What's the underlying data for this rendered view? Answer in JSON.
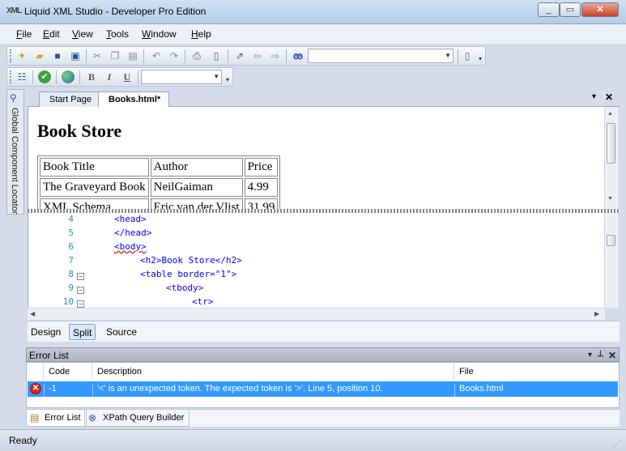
{
  "window": {
    "title": "Liquid XML Studio - Developer Pro Edition",
    "app_icon_text": "XML",
    "controls": {
      "minimize": "_",
      "maximize": "▭",
      "close": "✕"
    }
  },
  "menu": [
    {
      "label": "File",
      "key": "F",
      "rest": "ile"
    },
    {
      "label": "Edit",
      "key": "E",
      "rest": "dit"
    },
    {
      "label": "View",
      "key": "V",
      "rest": "iew"
    },
    {
      "label": "Tools",
      "key": "T",
      "rest": "ools"
    },
    {
      "label": "Window",
      "key": "W",
      "rest": "indow"
    },
    {
      "label": "Help",
      "key": "H",
      "rest": "elp"
    }
  ],
  "toolbar1": {
    "search_value": "",
    "icons": [
      "new-icon",
      "open-icon",
      "save-icon",
      "save-all-icon",
      "cut-icon",
      "copy-icon",
      "paste-icon",
      "undo-icon",
      "redo-icon",
      "print-icon",
      "print-preview-icon",
      "goto-icon",
      "back-icon",
      "forward-icon",
      "find-icon"
    ]
  },
  "toolbar2": {
    "bold": "B",
    "italic": "I",
    "underline": "U",
    "format_value": ""
  },
  "side_panel": {
    "label": "Global Component Locator"
  },
  "doc_tabs": [
    {
      "label": "Start Page",
      "active": false
    },
    {
      "label": "Books.html*",
      "active": true
    }
  ],
  "doc_tab_controls": {
    "dropdown": "▾",
    "close": "✕"
  },
  "design": {
    "heading": "Book Store",
    "table": {
      "headers": [
        "Book Title",
        "Author",
        "Price"
      ],
      "rows": [
        [
          "The Graveyard Book",
          "NeilGaiman",
          "4.99"
        ],
        [
          "XML Schema",
          "Eric van der Vlist",
          "31.99"
        ]
      ]
    }
  },
  "code": {
    "lines": [
      {
        "num": "4",
        "indent": "    ",
        "text": "<head>",
        "fold": false
      },
      {
        "num": "5",
        "indent": "    ",
        "text": "</head>",
        "fold": false
      },
      {
        "num": "6",
        "indent": "    ",
        "text": "<body>",
        "fold": false
      },
      {
        "num": "7",
        "indent": "        ",
        "text": "<h2>Book Store</h2>",
        "fold": false
      },
      {
        "num": "8",
        "indent": "        ",
        "text": "<table border=\"1\">",
        "fold": true
      },
      {
        "num": "9",
        "indent": "            ",
        "text": "<tbody>",
        "fold": true
      },
      {
        "num": "10",
        "indent": "                ",
        "text": "<tr>",
        "fold": true
      }
    ]
  },
  "view_tabs": [
    {
      "label": "Design",
      "active": false
    },
    {
      "label": "Split",
      "active": true
    },
    {
      "label": "Source",
      "active": false
    }
  ],
  "error_list": {
    "title": "Error List",
    "controls": {
      "dropdown": "▾",
      "pin": "📌",
      "close": "✕"
    },
    "columns": [
      "",
      "Code",
      "Description",
      "File"
    ],
    "rows": [
      {
        "code": "-1",
        "description": "'<' is an unexpected token. The expected token is '>'. Line 5, position 10.",
        "file": "Books.html"
      }
    ]
  },
  "bottom_tabs": [
    {
      "label": "Error List",
      "active": true
    },
    {
      "label": "XPath Query Builder",
      "active": false
    }
  ],
  "status": {
    "text": "Ready"
  },
  "colors": {
    "selection": "#3399ff",
    "tag": "#0000ff",
    "attr": "#ff0000",
    "line_number": "#2b91af"
  }
}
